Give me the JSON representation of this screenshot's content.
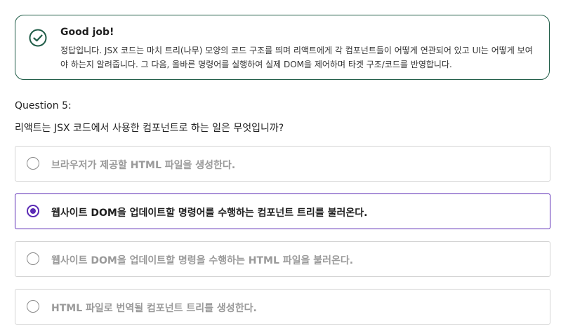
{
  "feedback": {
    "title": "Good job!",
    "body": "정답입니다. JSX 코드는 마치 트리(나무) 모양의 코드 구조를 띄며 리액트에게 각 컴포넌트들이 어떻게 연관되어 있고 UI는 어떻게 보여야 하는지 알려줍니다. 그 다음, 올바른 명령어를 실행하여 실제 DOM을 제어하며 타겟 구조/코드를 반영합니다.",
    "accent_color": "#1f5c47",
    "icon": "check-circle-icon"
  },
  "question": {
    "number_label": "Question 5:",
    "text": "리액트는 JSX 코드에서 사용한 컴포넌트로 하는 일은 무엇입니까?"
  },
  "options": [
    {
      "label": "브라우저가 제공할 HTML 파일을 생성한다.",
      "selected": false
    },
    {
      "label": "웹사이트 DOM을 업데이트할 명령어를 수행하는 컴포넌트 트리를 불러온다.",
      "selected": true
    },
    {
      "label": "웹사이트 DOM을 업데이트할 명령을 수행하는 HTML 파일을 불러온다.",
      "selected": false
    },
    {
      "label": "HTML 파일로 번역될 컴포넌트 트리를 생성한다.",
      "selected": false
    }
  ],
  "colors": {
    "selected_accent": "#5b2bb5",
    "unselected_text": "#9a9a9a"
  }
}
